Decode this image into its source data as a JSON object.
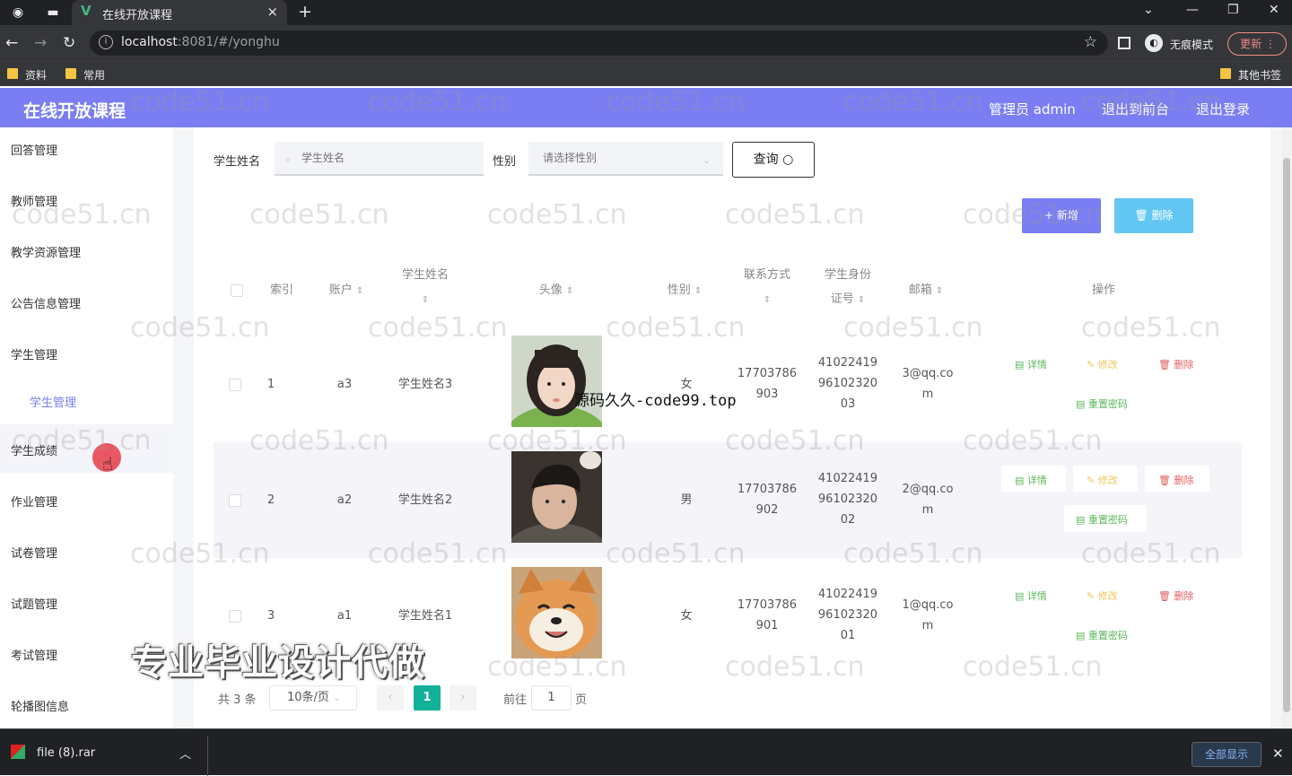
{
  "browser": {
    "tab_title": "在线开放课程",
    "tab_close": "×",
    "new_tab": "+",
    "url_host": "localhost",
    "url_path": ":8081/#/yonghu",
    "incognito_label": "无痕模式",
    "update_label": "更新",
    "bookmarks": [
      "资料",
      "常用"
    ],
    "other_bookmarks": "其他书签"
  },
  "header": {
    "title": "在线开放课程",
    "user": "管理员 admin",
    "to_front": "退出到前台",
    "logout": "退出登录"
  },
  "sidebar": {
    "items": [
      "回答管理",
      "教师管理",
      "教学资源管理",
      "公告信息管理",
      "学生管理",
      "学生管理",
      "学生成绩",
      "作业管理",
      "试卷管理",
      "试题管理",
      "考试管理",
      "轮播图信息"
    ]
  },
  "search": {
    "name_label": "学生姓名",
    "name_placeholder": "学生姓名",
    "gender_label": "性别",
    "gender_placeholder": "请选择性别",
    "query_button": "查询"
  },
  "toolbar": {
    "add": "新增",
    "delete": "删除"
  },
  "table": {
    "headers": {
      "index": "索引",
      "account": "账户",
      "name_1": "学生姓名",
      "avatar": "头像",
      "gender": "性别",
      "phone_1": "联系方式",
      "idcard_1": "学生身份",
      "idcard_2": "证号",
      "email": "邮箱",
      "actions": "操作"
    },
    "rows": [
      {
        "index": "1",
        "account": "a3",
        "name": "学生姓名3",
        "gender": "女",
        "phone_1": "17703786",
        "phone_2": "903",
        "id_1": "41022419",
        "id_2": "96102320",
        "id_3": "03",
        "email_1": "3@qq.co",
        "email_2": "m"
      },
      {
        "index": "2",
        "account": "a2",
        "name": "学生姓名2",
        "gender": "男",
        "phone_1": "17703786",
        "phone_2": "902",
        "id_1": "41022419",
        "id_2": "96102320",
        "id_3": "02",
        "email_1": "2@qq.co",
        "email_2": "m"
      },
      {
        "index": "3",
        "account": "a1",
        "name": "学生姓名1",
        "gender": "女",
        "phone_1": "17703786",
        "phone_2": "901",
        "id_1": "41022419",
        "id_2": "96102320",
        "id_3": "01",
        "email_1": "1@qq.co",
        "email_2": "m"
      }
    ],
    "actions": {
      "detail": "详情",
      "edit": "修改",
      "delete": "删除",
      "reset": "重置密码"
    }
  },
  "pagination": {
    "total": "共 3 条",
    "page_size": "10条/页",
    "current": "1",
    "goto_label": "前往",
    "goto_value": "1",
    "page_suffix": "页"
  },
  "overlays": {
    "watermark": "code51.cn",
    "floating_text": "源码久久-code99.top",
    "promo": "专业毕业设计代做"
  },
  "download": {
    "file": "file (8).rar",
    "show_all": "全部显示"
  },
  "colors": {
    "primary": "#7a7ef2",
    "info": "#62c6f2",
    "pagination_active": "#13b09a"
  }
}
